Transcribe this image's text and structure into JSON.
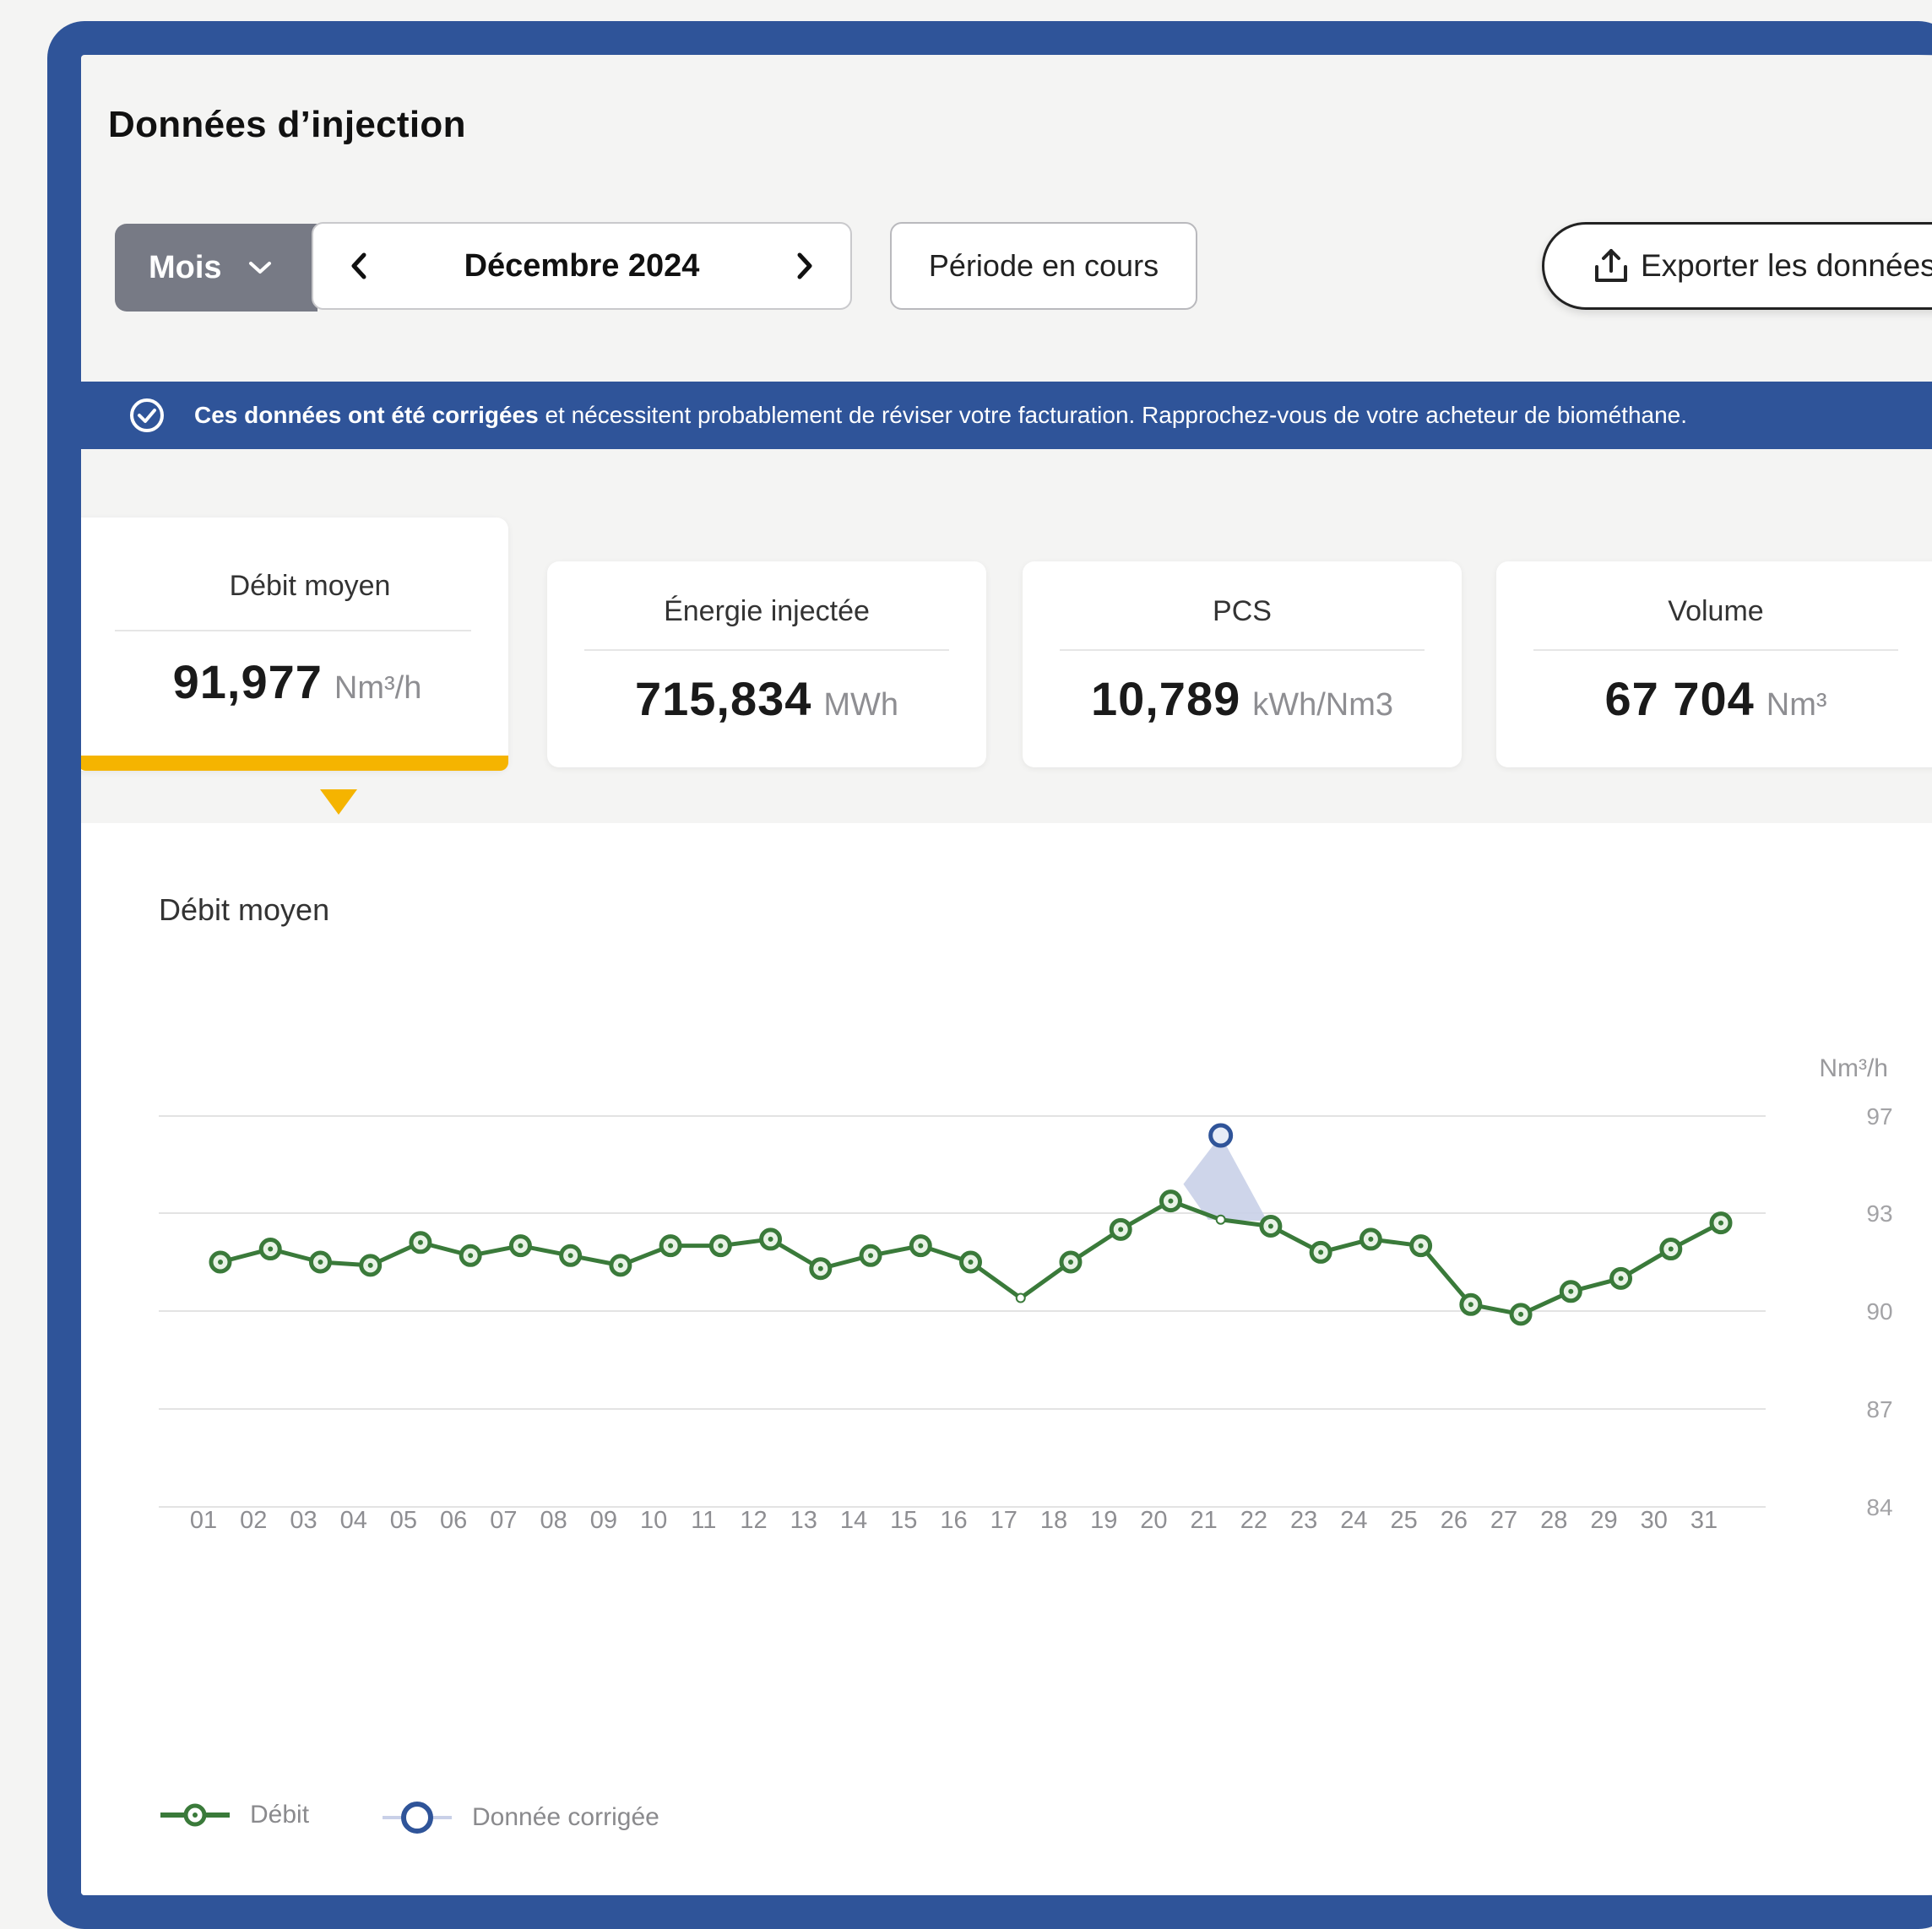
{
  "page": {
    "title": "Données d’injection"
  },
  "toolbar": {
    "period_type": "Mois",
    "current_period": "Décembre 2024",
    "current_period_button": "Période en cours",
    "export_button": "Exporter les données"
  },
  "banner": {
    "strong_text": "Ces données ont été corrigées",
    "text": " et nécessitent probablement de réviser votre facturation. Rapprochez-vous de votre acheteur de biométhane."
  },
  "kpis": [
    {
      "label": "Débit moyen",
      "value": "91,977",
      "unit": "Nm³/h",
      "active": true
    },
    {
      "label": "Énergie injectée",
      "value": "715,834",
      "unit": "MWh"
    },
    {
      "label": "PCS",
      "value": "10,789",
      "unit": "kWh/Nm3"
    },
    {
      "label": "Volume",
      "value": "67 704",
      "unit": "Nm³"
    }
  ],
  "colors": {
    "frame": "#2f5499",
    "accent": "#f5b400",
    "series_debit": "#3a7a3a",
    "series_corrected": "#2f5499",
    "corrected_area": "#c9d0e8"
  },
  "chart_data": {
    "type": "line",
    "title": "Débit moyen",
    "ylabel": "Nm³/h",
    "ylim": [
      84,
      97
    ],
    "yticks": [
      97,
      93,
      90,
      87,
      84
    ],
    "grid": true,
    "legend_position": "bottom-left",
    "categories": [
      "01",
      "02",
      "03",
      "04",
      "05",
      "06",
      "07",
      "08",
      "09",
      "10",
      "11",
      "12",
      "13",
      "14",
      "15",
      "16",
      "17",
      "18",
      "19",
      "20",
      "21",
      "22",
      "23",
      "24",
      "25",
      "26",
      "27",
      "28",
      "29",
      "30",
      "31"
    ],
    "series": [
      {
        "name": "Débit",
        "values": [
          91.5,
          91.9,
          91.5,
          91.4,
          92.1,
          91.7,
          92.0,
          91.7,
          91.4,
          92.0,
          92.0,
          92.2,
          91.3,
          91.7,
          92.0,
          91.5,
          90.4,
          91.5,
          92.5,
          93.5,
          92.8,
          92.6,
          91.8,
          92.2,
          92.0,
          90.2,
          89.9,
          90.6,
          91.0,
          91.9,
          92.7
        ],
        "markers": [
          true,
          true,
          true,
          true,
          true,
          true,
          true,
          true,
          true,
          true,
          true,
          true,
          true,
          true,
          true,
          true,
          false,
          true,
          true,
          true,
          false,
          true,
          true,
          true,
          true,
          true,
          true,
          true,
          true,
          true,
          true
        ]
      },
      {
        "name": "Donnée corrigée",
        "points": [
          {
            "x": "21",
            "y": 96.2
          }
        ]
      }
    ],
    "legend": [
      "Débit",
      "Donnée corrigée"
    ]
  }
}
